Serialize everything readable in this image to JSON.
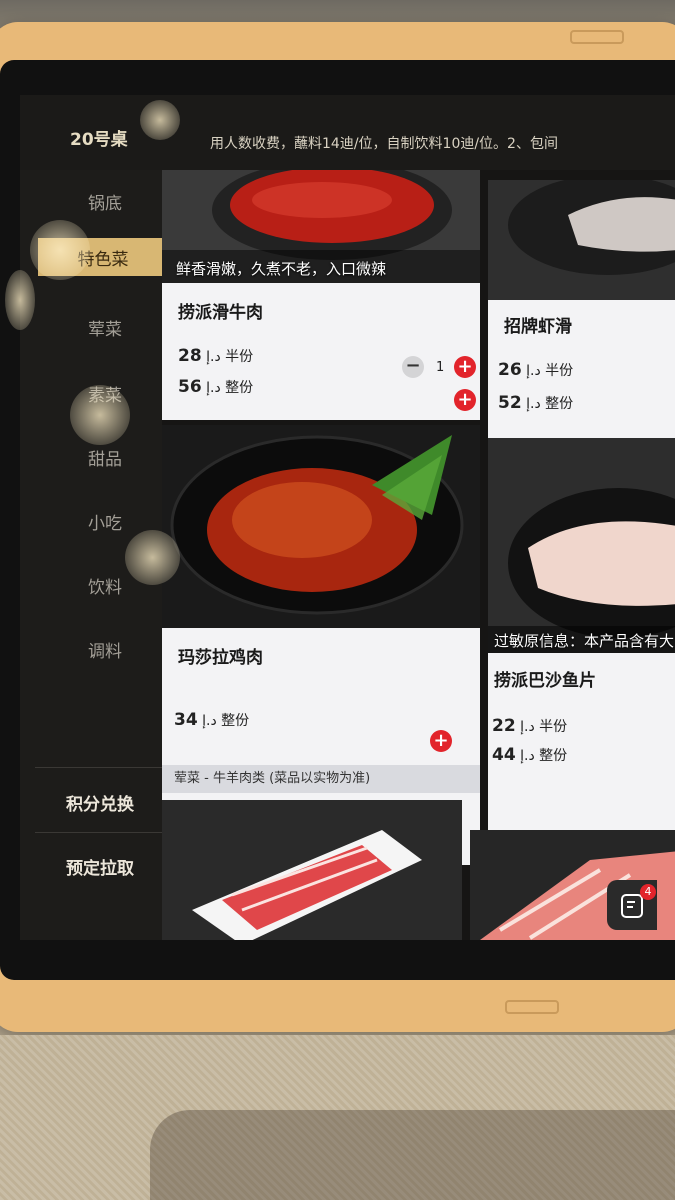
{
  "header": {
    "table_number": "20号桌",
    "notice": "用人数收费，蘸料14迪/位，自制饮料10迪/位。2、包间"
  },
  "sidebar": {
    "items": [
      {
        "label": "锅底",
        "active": false
      },
      {
        "label": "特色菜",
        "active": true
      },
      {
        "label": "荤菜",
        "active": false
      },
      {
        "label": "素菜",
        "active": false
      },
      {
        "label": "甜品",
        "active": false
      },
      {
        "label": "小吃",
        "active": false
      },
      {
        "label": "饮料",
        "active": false
      },
      {
        "label": "调料",
        "active": false
      }
    ],
    "points_exchange": "积分兑换",
    "reserve_pickup": "预定拉取"
  },
  "dishes": [
    {
      "name": "捞派滑牛肉",
      "caption": "鲜香滑嫩，久煮不老，入口微辣",
      "half_price": "28",
      "half_unit": "د.إ 半份",
      "full_price": "56",
      "full_unit": "د.إ 整份",
      "qty": "1",
      "minus": "−",
      "add": "+"
    },
    {
      "name": "招牌虾滑",
      "half_price": "26",
      "half_unit": "د.إ 半份",
      "full_price": "52",
      "full_unit": "د.إ 整份"
    },
    {
      "name": "玛莎拉鸡肉",
      "full_price": "34",
      "full_unit": "د.إ 整份",
      "add": "+"
    },
    {
      "name": "捞派巴沙鱼片",
      "caption": "过敏原信息：本产品含有大",
      "half_price": "22",
      "half_unit": "د.إ 半份",
      "full_price": "44",
      "full_unit": "د.إ 整份"
    }
  ],
  "category_label": "荤菜 - 牛羊肉类 (菜品以实物为准)",
  "cart": {
    "badge": "4",
    "icon": "order-list-icon"
  },
  "colors": {
    "accent": "#e2242b",
    "active_nav": "#d8b773",
    "frame": "#e8b978"
  }
}
